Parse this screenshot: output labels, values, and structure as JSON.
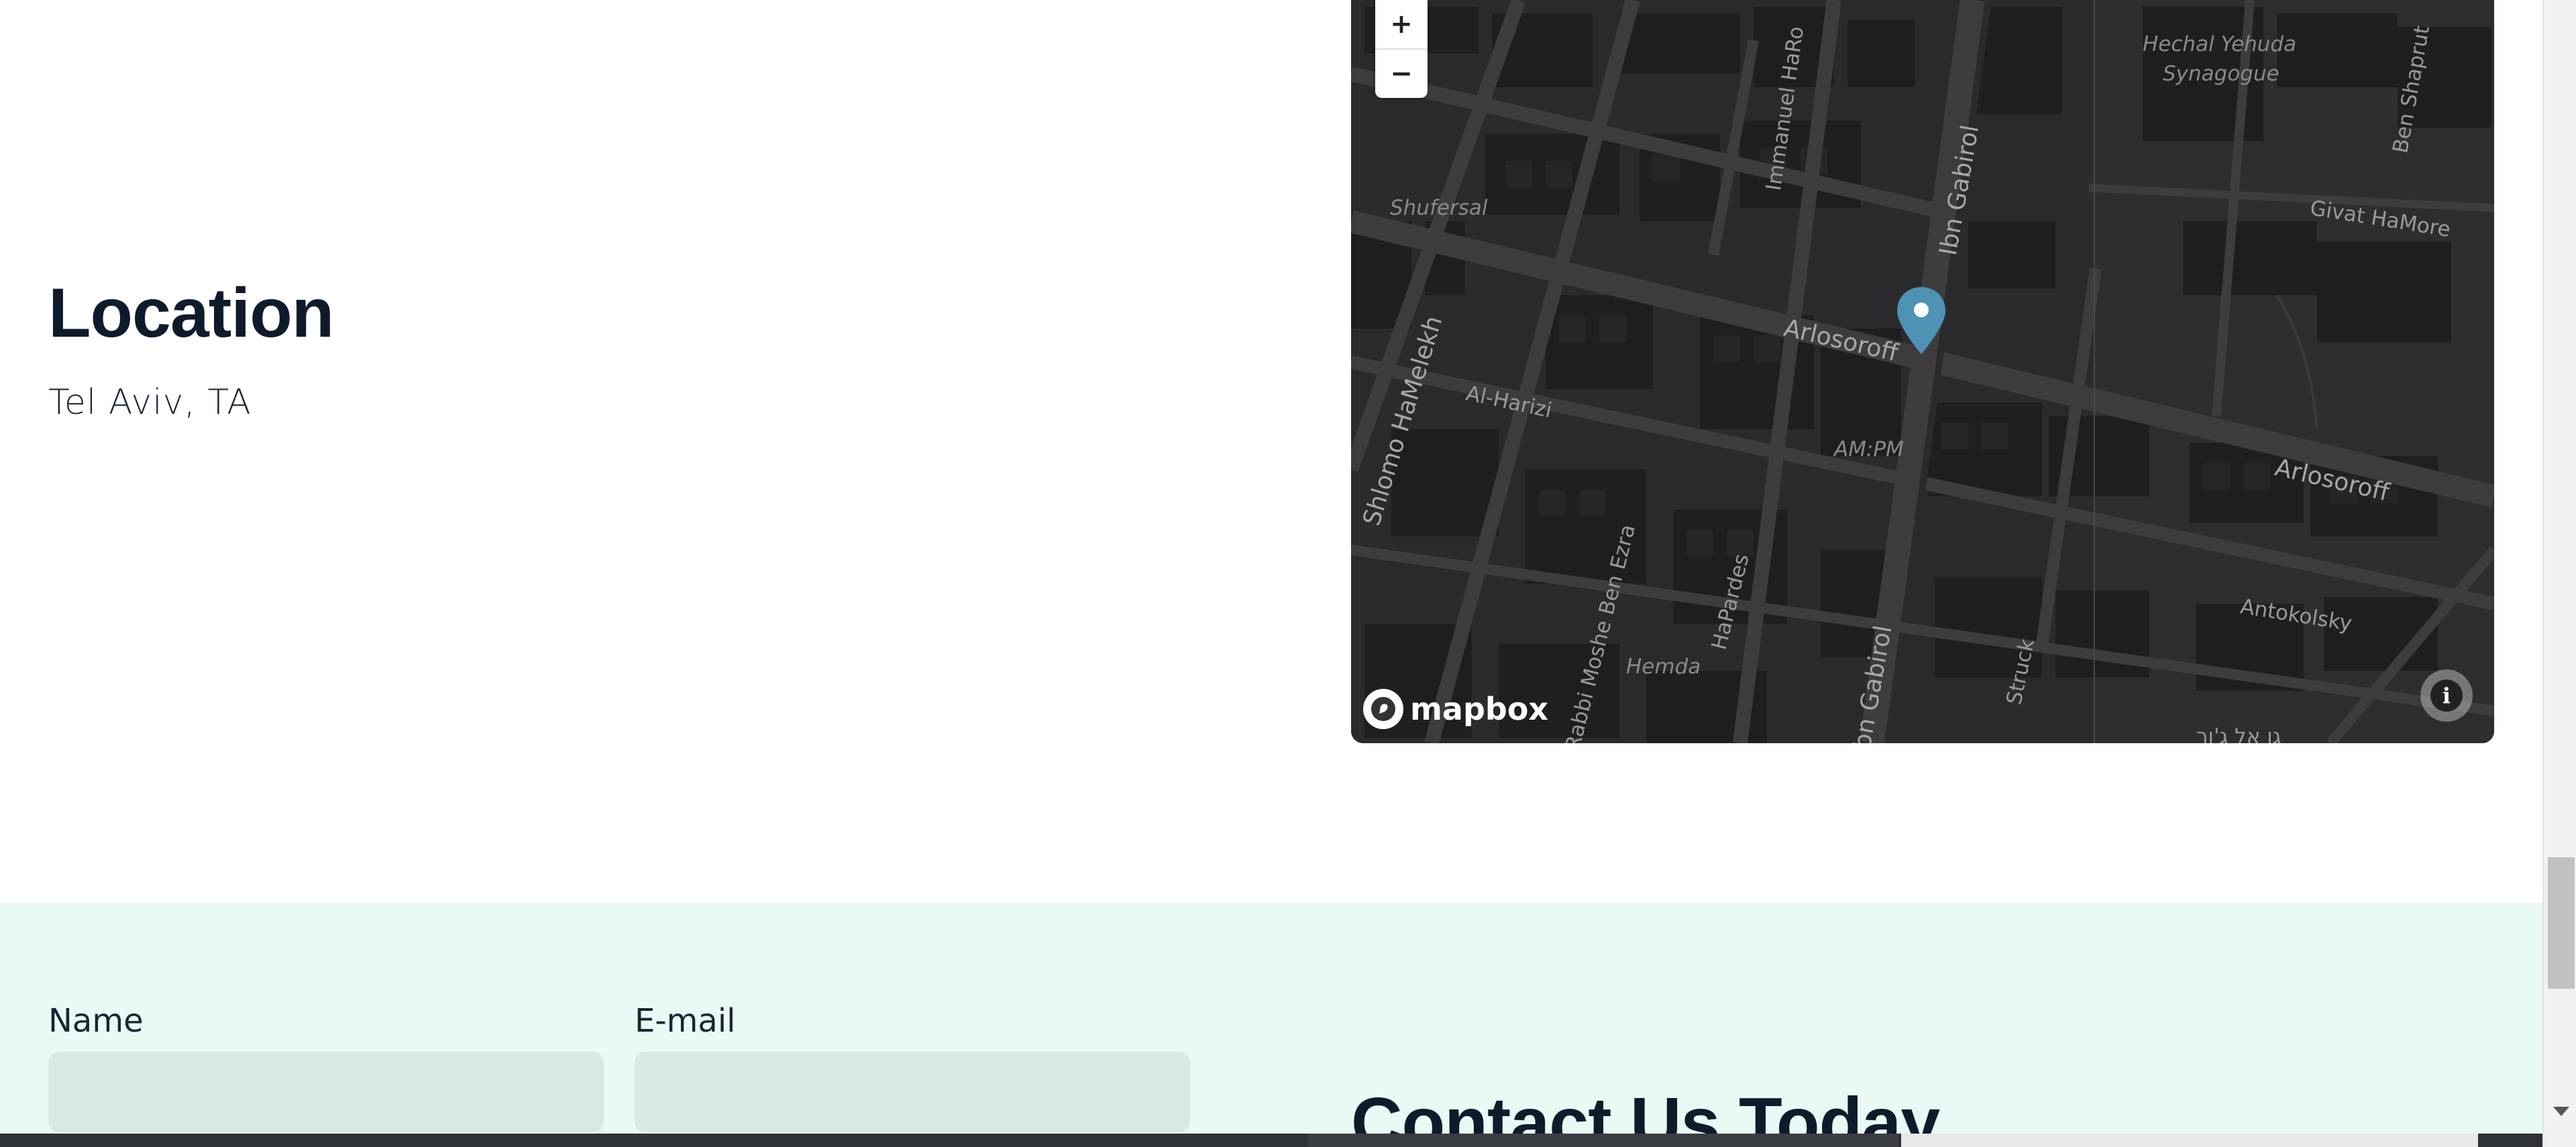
{
  "location": {
    "title": "Location",
    "subtitle": "Tel Aviv, TA"
  },
  "map": {
    "zoom_in": "+",
    "zoom_out": "−",
    "provider": "mapbox",
    "info": "i",
    "labels": {
      "hechal": "Hechal Yehuda",
      "synagogue": "Synagogue",
      "ben_shaprut": "Ben Shaprut",
      "immanuel": "Immanuel HaRo",
      "ibn_gabirol_top": "Ibn Gabirol",
      "givat": "Givat HaMore",
      "shufersal": "Shufersal",
      "arlosoroff_1": "Arlosoroff",
      "shlomo": "Shlomo HaMelekh",
      "al_harizi": "Al-Harizi",
      "ampm": "AM:PM",
      "arlosoroff_2": "Arlosoroff",
      "antokolsky": "Antokolsky",
      "rabbi": "Rabbi Moshe Ben Ezra",
      "hapardes": "HaPardes",
      "hemda": "Hemda",
      "ibn_gabirol_bottom": "Ibn Gabirol",
      "struck": "Struck",
      "hebrew": "גן אל ג'ןר"
    },
    "colors": {
      "background": "#2b2b2d",
      "pin": "#4e93b4"
    }
  },
  "contact": {
    "name_label": "Name",
    "email_label": "E-mail",
    "title": "Contact Us Today"
  },
  "colors": {
    "contact_bg": "#e9f9f3",
    "input_bg": "#d8e9e3",
    "heading": "#0f1b2b"
  }
}
